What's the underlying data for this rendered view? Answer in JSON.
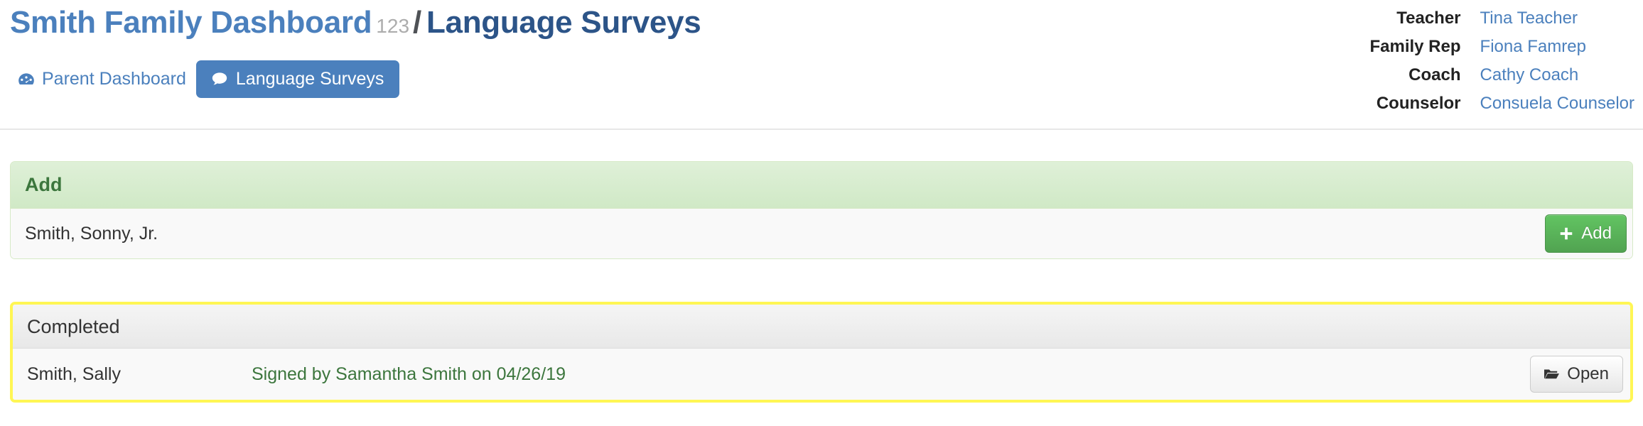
{
  "header": {
    "title": {
      "family": "Smith Family Dashboard",
      "id": "123",
      "separator": "/",
      "section": "Language Surveys"
    },
    "nav": [
      {
        "label": "Parent Dashboard",
        "icon": "tachometer-icon",
        "active": false
      },
      {
        "label": "Language Surveys",
        "icon": "comment-icon",
        "active": true
      }
    ],
    "contacts": [
      {
        "label": "Teacher",
        "value": "Tina Teacher"
      },
      {
        "label": "Family Rep",
        "value": "Fiona Famrep"
      },
      {
        "label": "Coach",
        "value": "Cathy Coach"
      },
      {
        "label": "Counselor",
        "value": "Consuela Counselor"
      }
    ]
  },
  "panels": {
    "add": {
      "title": "Add",
      "row": {
        "name": "Smith, Sonny, Jr.",
        "button": {
          "label": "Add",
          "icon": "plus-icon"
        }
      }
    },
    "completed": {
      "title": "Completed",
      "row": {
        "name": "Smith, Sally",
        "status": "Signed by Samantha Smith on 04/26/19",
        "button": {
          "label": "Open",
          "icon": "folder-open-icon"
        }
      }
    }
  },
  "colors": {
    "link_blue": "#4b80bd",
    "title_section_blue": "#2c5488",
    "success_green": "#3c763d",
    "add_button_green": "#51a351",
    "highlight_yellow": "#fff654",
    "panel_success_bg": "#dff0d8",
    "muted_gray": "#adadad"
  }
}
